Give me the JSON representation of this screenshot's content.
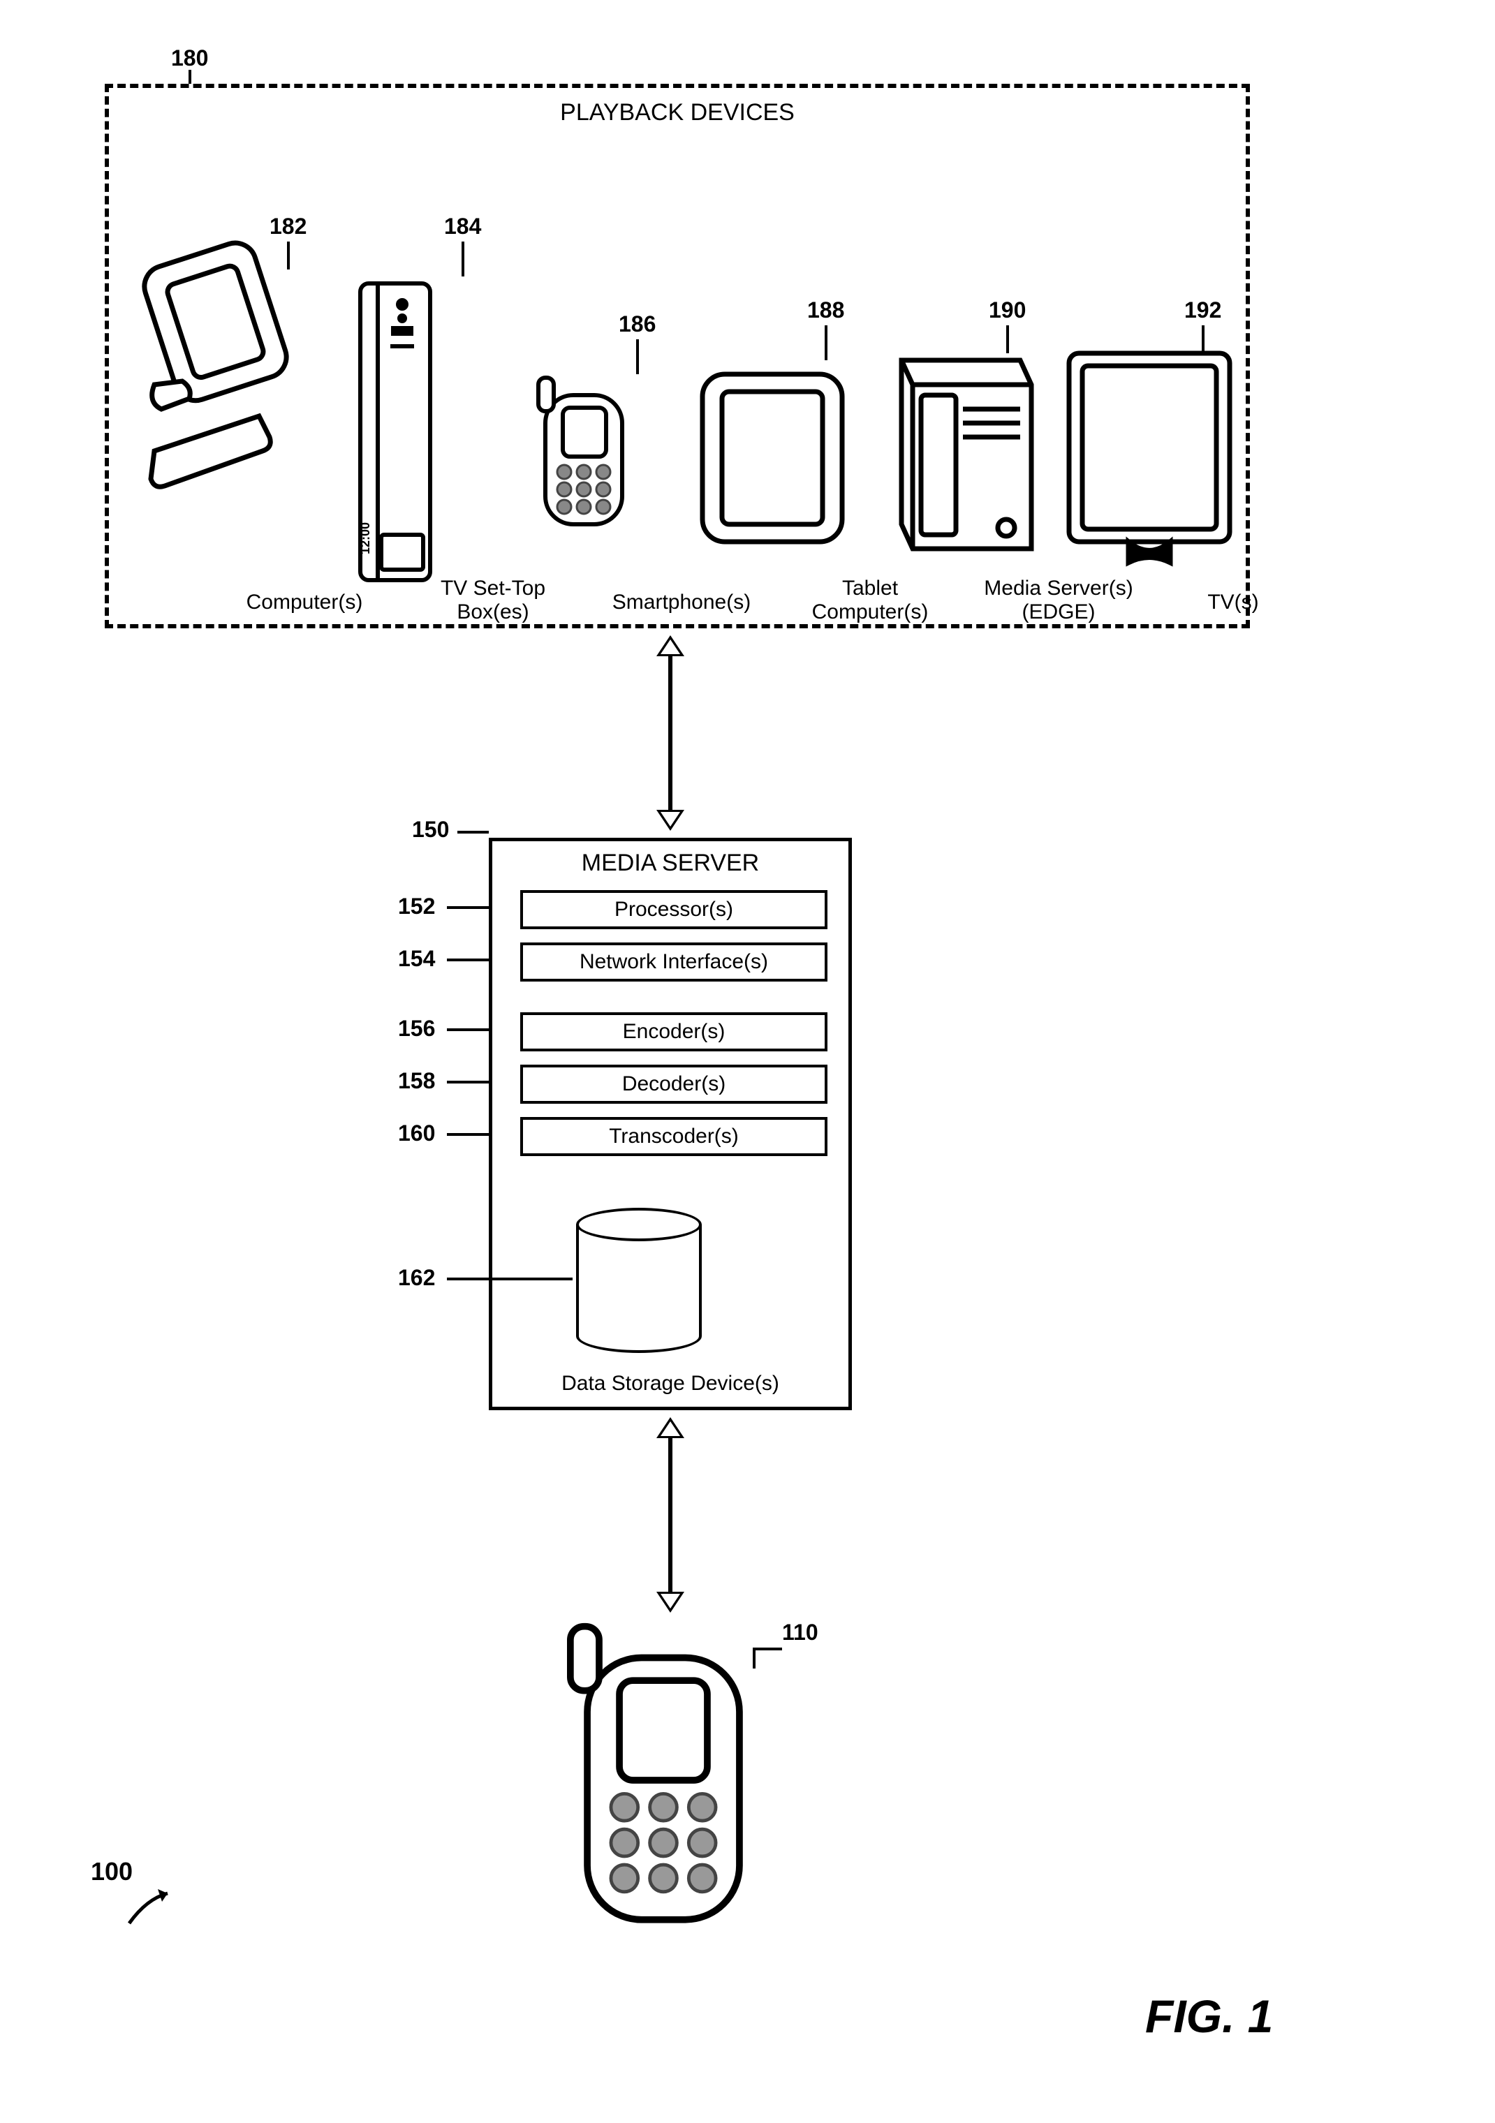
{
  "figure_label": "FIG. 1",
  "system_ref": "100",
  "capture_ref": "110",
  "media_server": {
    "title": "MEDIA SERVER",
    "ref": "150",
    "components": [
      {
        "ref": "152",
        "label": "Processor(s)"
      },
      {
        "ref": "154",
        "label": "Network Interface(s)"
      },
      {
        "ref": "156",
        "label": "Encoder(s)"
      },
      {
        "ref": "158",
        "label": "Decoder(s)"
      },
      {
        "ref": "160",
        "label": "Transcoder(s)"
      },
      {
        "ref": "162",
        "label": "Data Storage Device(s)"
      }
    ]
  },
  "playback": {
    "title": "PLAYBACK DEVICES",
    "ref": "180",
    "devices": [
      {
        "ref": "182",
        "label": "Computer(s)"
      },
      {
        "ref": "184",
        "label": "TV Set-Top\nBox(es)",
        "extra": "12:00"
      },
      {
        "ref": "186",
        "label": "Smartphone(s)"
      },
      {
        "ref": "188",
        "label": "Tablet\nComputer(s)"
      },
      {
        "ref": "190",
        "label": "Media Server(s)\n(EDGE)"
      },
      {
        "ref": "192",
        "label": "TV(s)"
      }
    ]
  }
}
